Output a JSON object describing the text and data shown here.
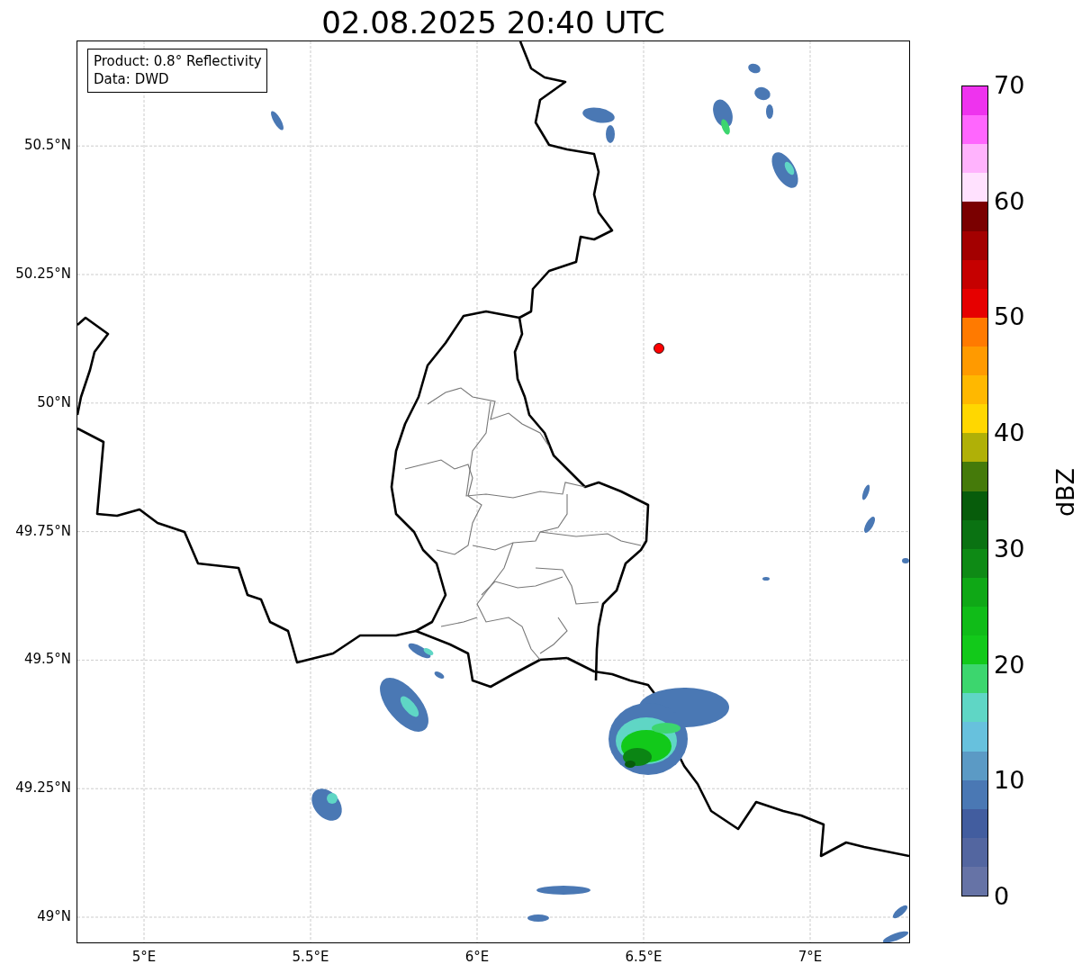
{
  "title": "02.08.2025 20:40 UTC",
  "info_box": [
    "Product: 0.8° Reflectivity",
    "Data: DWD"
  ],
  "lat_ticks": [
    "50.5°N",
    "50.25°N",
    "50°N",
    "49.75°N",
    "49.5°N",
    "49.25°N",
    "49°N"
  ],
  "lon_ticks": [
    "5°E",
    "5.5°E",
    "6°E",
    "6.5°E",
    "7°E"
  ],
  "colorbar": {
    "label": "dBZ",
    "ticks": [
      "70",
      "60",
      "50",
      "40",
      "30",
      "20",
      "10",
      "0"
    ],
    "bands": [
      {
        "color": "#ee33ee"
      },
      {
        "color": "#ff66fe"
      },
      {
        "color": "#ffb3fd"
      },
      {
        "color": "#ffe1fe"
      },
      {
        "color": "#7a0000"
      },
      {
        "color": "#a30000"
      },
      {
        "color": "#c60000"
      },
      {
        "color": "#e60000"
      },
      {
        "color": "#ff7a00"
      },
      {
        "color": "#ff9a00"
      },
      {
        "color": "#ffb800"
      },
      {
        "color": "#ffd700"
      },
      {
        "color": "#b0b007"
      },
      {
        "color": "#457a0a"
      },
      {
        "color": "#075c0b"
      },
      {
        "color": "#0a7212"
      },
      {
        "color": "#0e8a15"
      },
      {
        "color": "#0fa816"
      },
      {
        "color": "#10bc18"
      },
      {
        "color": "#12c91a"
      },
      {
        "color": "#3cd66e"
      },
      {
        "color": "#5fd6c5"
      },
      {
        "color": "#67c1dd"
      },
      {
        "color": "#5b9ac5"
      },
      {
        "color": "#4a78b4"
      },
      {
        "color": "#425d9f"
      },
      {
        "color": "#5366a0"
      },
      {
        "color": "#6673a6"
      }
    ]
  }
}
